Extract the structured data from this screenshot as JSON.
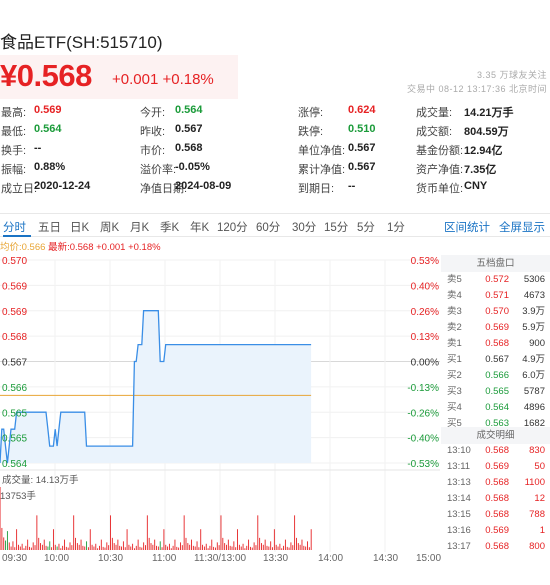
{
  "header": {
    "title": "食品ETF(SH:515710)",
    "price": "¥0.568",
    "change": "+0.001 +0.18%",
    "follow": "3.35 万球友关注",
    "status": "交易中 08-12 13:17:36 北京时间"
  },
  "quote": {
    "rows": [
      [
        {
          "l": "最高:",
          "v": "0.569",
          "c": "red"
        },
        {
          "l": "今开:",
          "v": "0.564",
          "c": "green"
        },
        {
          "l": "涨停:",
          "v": "0.624",
          "c": "red"
        },
        {
          "l": "成交量:",
          "v": "14.21万手",
          "c": ""
        }
      ],
      [
        {
          "l": "最低:",
          "v": "0.564",
          "c": "green"
        },
        {
          "l": "昨收:",
          "v": "0.567",
          "c": ""
        },
        {
          "l": "跌停:",
          "v": "0.510",
          "c": "green"
        },
        {
          "l": "成交额:",
          "v": "804.59万",
          "c": ""
        }
      ],
      [
        {
          "l": "换手:",
          "v": "--",
          "c": ""
        },
        {
          "l": "市价:",
          "v": "0.568",
          "c": ""
        },
        {
          "l": "单位净值:",
          "v": "0.567",
          "c": ""
        },
        {
          "l": "基金份额:",
          "v": "12.94亿",
          "c": ""
        }
      ],
      [
        {
          "l": "振幅:",
          "v": "0.88%",
          "c": ""
        },
        {
          "l": "溢价率:",
          "v": "-0.05%",
          "c": ""
        },
        {
          "l": "累计净值:",
          "v": "0.567",
          "c": ""
        },
        {
          "l": "资产净值:",
          "v": "7.35亿",
          "c": ""
        }
      ],
      [
        {
          "l": "成立日:",
          "v": "2020-12-24",
          "c": ""
        },
        {
          "l": "净值日期:",
          "v": "2024-08-09",
          "c": ""
        },
        {
          "l": "到期日:",
          "v": "--",
          "c": ""
        },
        {
          "l": "货币单位:",
          "v": "CNY",
          "c": ""
        }
      ]
    ]
  },
  "tabs": {
    "items": [
      "分时",
      "五日",
      "日K",
      "周K",
      "月K",
      "季K",
      "年K",
      "120分",
      "60分",
      "30分",
      "15分",
      "5分",
      "1分"
    ],
    "right": [
      "区间统计",
      "全屏显示"
    ]
  },
  "chart_info": {
    "avg": "均价:0.566",
    "latest": "最新:0.568 +0.001 +0.18%",
    "volume_label": "成交量: 14.13万手",
    "volume_max": "13753手"
  },
  "chart_data": {
    "type": "line",
    "prev_close": 0.567,
    "ylim": [
      0.564,
      0.57
    ],
    "y_ticks_left": [
      "0.570",
      "0.569",
      "0.569",
      "0.568",
      "0.567",
      "0.566",
      "0.565",
      "0.565",
      "0.564"
    ],
    "y_ticks_right": [
      "0.53%",
      "0.40%",
      "0.26%",
      "0.13%",
      "0.00%",
      "-0.13%",
      "-0.26%",
      "-0.40%",
      "-0.53%"
    ],
    "x_ticks": [
      "09:30",
      "10:00",
      "10:30",
      "11:00",
      "11:30/13:00",
      "13:30",
      "14:00",
      "14:30",
      "15:00"
    ],
    "price_series": {
      "name": "price",
      "x": [
        0,
        1,
        2,
        3,
        4,
        5,
        6,
        7,
        8,
        9,
        10,
        11,
        12,
        13,
        14,
        15,
        16,
        17,
        18,
        19,
        20,
        21,
        22,
        23,
        24,
        25,
        26,
        27,
        28,
        29,
        30,
        31,
        32,
        33,
        34,
        35,
        36,
        37,
        38,
        39,
        40,
        41,
        42,
        43,
        44,
        45,
        46,
        47,
        48,
        49,
        50,
        51,
        52,
        53,
        54,
        55,
        56,
        57,
        58,
        59,
        60,
        61,
        62,
        63,
        64,
        65,
        66,
        67,
        68,
        69,
        70,
        71,
        72,
        73,
        74,
        75,
        76,
        77,
        78,
        79,
        80,
        81,
        82,
        83,
        84,
        85,
        86,
        87,
        88,
        89,
        90,
        91,
        92,
        93,
        94,
        95,
        96,
        97,
        98,
        99,
        100,
        101,
        102,
        103,
        104,
        105,
        106,
        107,
        108,
        109,
        110,
        111,
        112,
        113,
        114,
        115,
        116,
        117,
        118,
        119,
        120,
        121,
        122,
        123,
        124,
        125,
        126,
        127,
        128,
        129,
        130,
        131,
        132,
        133,
        134,
        135,
        136,
        137,
        138,
        139,
        140,
        141,
        142,
        143,
        144,
        145,
        146,
        147,
        148,
        149,
        150,
        151,
        152,
        153,
        154,
        155,
        156,
        157,
        158,
        159,
        160,
        161,
        162,
        163,
        164,
        165,
        166,
        167,
        168
      ],
      "values": [
        0.564,
        0.565,
        0.565,
        0.5645,
        0.564,
        0.5645,
        0.565,
        0.565,
        0.565,
        0.5655,
        0.5655,
        0.5655,
        0.5655,
        0.5655,
        0.5655,
        0.5655,
        0.5655,
        0.5655,
        0.5655,
        0.5655,
        0.5655,
        0.5655,
        0.5655,
        0.5655,
        0.5655,
        0.5655,
        0.565,
        0.5645,
        0.5645,
        0.5645,
        0.565,
        0.5645,
        0.565,
        0.5655,
        0.5655,
        0.5655,
        0.5655,
        0.5655,
        0.5655,
        0.5655,
        0.5655,
        0.5655,
        0.5655,
        0.5655,
        0.5655,
        0.5655,
        0.5655,
        0.5645,
        0.5645,
        0.5645,
        0.5645,
        0.5645,
        0.5645,
        0.5645,
        0.5645,
        0.5645,
        0.5645,
        0.5645,
        0.5645,
        0.5645,
        0.5645,
        0.5645,
        0.5645,
        0.5645,
        0.5645,
        0.5645,
        0.5645,
        0.5645,
        0.5645,
        0.5645,
        0.5645,
        0.5645,
        0.5645,
        0.567,
        0.567,
        0.5675,
        0.5675,
        0.5675,
        0.5685,
        0.5685,
        0.5685,
        0.5685,
        0.5685,
        0.5685,
        0.5685,
        0.5685,
        0.5685,
        0.567,
        0.567,
        0.567,
        0.5675,
        0.5675,
        0.5675,
        0.5675,
        0.5675,
        0.5675,
        0.5675,
        0.5675,
        0.5675,
        0.5675,
        0.5675,
        0.5675,
        0.5675,
        0.5675,
        0.5675,
        0.5675,
        0.5675,
        0.5675,
        0.5675,
        0.5675,
        0.5675,
        0.5675,
        0.5675,
        0.5675,
        0.5675,
        0.5675,
        0.5675,
        0.5675,
        0.5675,
        0.5675,
        0.5675,
        0.5675,
        0.5675,
        0.5675,
        0.5675,
        0.5675,
        0.5675,
        0.5675,
        0.5675,
        0.5675,
        0.5675,
        0.5675,
        0.5675,
        0.5675,
        0.5675,
        0.5675,
        0.5675,
        0.5675,
        0.5675,
        0.5675,
        0.5675,
        0.5675,
        0.5675,
        0.5675,
        0.5675,
        0.5675,
        0.5675,
        0.5675,
        0.5675,
        0.5675,
        0.5675,
        0.5675,
        0.5675,
        0.5675,
        0.5675,
        0.5675,
        0.5675,
        0.5675,
        0.5675,
        0.5675,
        0.5675,
        0.5675,
        0.5675,
        0.5675,
        0.5675,
        0.5675,
        0.5675,
        0.5675,
        0.5675,
        0.5675
      ]
    },
    "avg_value": 0.566,
    "volume_series": {
      "name": "volume",
      "max": 13753
    }
  },
  "orderbook": {
    "title": "五档盘口",
    "rows": [
      {
        "k": "卖5",
        "p": "0.572",
        "v": "5306",
        "c": "red"
      },
      {
        "k": "卖4",
        "p": "0.571",
        "v": "4673",
        "c": "red"
      },
      {
        "k": "卖3",
        "p": "0.570",
        "v": "3.9万",
        "c": "red"
      },
      {
        "k": "卖2",
        "p": "0.569",
        "v": "5.9万",
        "c": "red"
      },
      {
        "k": "卖1",
        "p": "0.568",
        "v": "900",
        "c": "red"
      },
      {
        "k": "买1",
        "p": "0.567",
        "v": "4.9万",
        "c": ""
      },
      {
        "k": "买2",
        "p": "0.566",
        "v": "6.0万",
        "c": "green"
      },
      {
        "k": "买3",
        "p": "0.565",
        "v": "5787",
        "c": "green"
      },
      {
        "k": "买4",
        "p": "0.564",
        "v": "4896",
        "c": "green"
      },
      {
        "k": "买5",
        "p": "0.563",
        "v": "1682",
        "c": "green"
      }
    ]
  },
  "trades": {
    "title": "成交明细",
    "rows": [
      {
        "t": "13:10",
        "p": "0.568",
        "v": "830"
      },
      {
        "t": "13:11",
        "p": "0.569",
        "v": "50"
      },
      {
        "t": "13:13",
        "p": "0.568",
        "v": "1100"
      },
      {
        "t": "13:14",
        "p": "0.568",
        "v": "12"
      },
      {
        "t": "13:15",
        "p": "0.568",
        "v": "788"
      },
      {
        "t": "13:16",
        "p": "0.569",
        "v": "1"
      },
      {
        "t": "13:17",
        "p": "0.568",
        "v": "800"
      }
    ]
  },
  "colors": {
    "up": "#e62224",
    "down": "#1b9b3a",
    "price_line": "#3a8ee6",
    "avg_line": "#e8a535",
    "accent": "#1a73c4"
  }
}
